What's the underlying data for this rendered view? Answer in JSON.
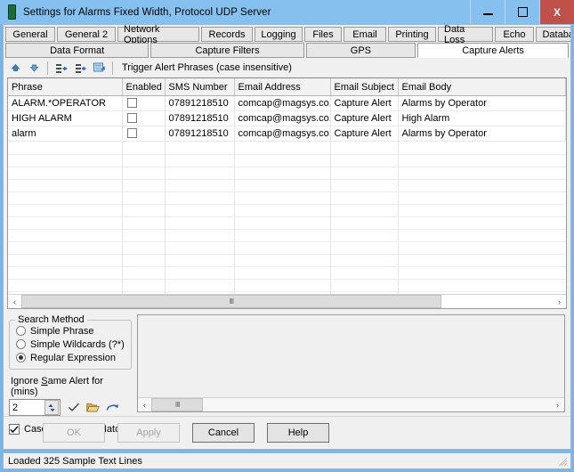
{
  "window": {
    "title": "Settings for Alarms Fixed Width, Protocol UDP Server",
    "icon": "document-icon",
    "minimize_label": "–",
    "maximize_label": "□",
    "close_label": "X"
  },
  "tabs": {
    "row1": [
      {
        "label": "General",
        "selected": false
      },
      {
        "label": "General 2",
        "selected": false
      },
      {
        "label": "Network Options",
        "selected": false
      },
      {
        "label": "Records",
        "selected": false
      },
      {
        "label": "Logging",
        "selected": false
      },
      {
        "label": "Files",
        "selected": false
      },
      {
        "label": "Email",
        "selected": false
      },
      {
        "label": "Printing",
        "selected": false
      },
      {
        "label": "Data Loss",
        "selected": false
      },
      {
        "label": "Echo",
        "selected": false
      },
      {
        "label": "Database",
        "selected": false
      }
    ],
    "row2": [
      {
        "label": "Data Format",
        "selected": false
      },
      {
        "label": "Capture Filters",
        "selected": false
      },
      {
        "label": "GPS",
        "selected": false
      },
      {
        "label": "Capture Alerts",
        "selected": true
      }
    ]
  },
  "toolbar": {
    "move_up": "move-up-icon",
    "move_down": "move-down-icon",
    "insert_row": "insert-row-icon",
    "delete_row": "delete-row-icon",
    "edit_row": "edit-row-icon",
    "caption": "Trigger Alert Phrases (case insensitive)"
  },
  "grid": {
    "columns": [
      "Phrase",
      "Enabled",
      "SMS Number",
      "Email Address",
      "Email Subject",
      "Email Body"
    ],
    "rows": [
      {
        "phrase": "ALARM.*OPERATOR",
        "enabled": false,
        "sms": "07891218510",
        "email": "comcap@magsys.co.uk",
        "subject": "Capture Alert",
        "body": "Alarms by Operator"
      },
      {
        "phrase": "HIGH ALARM",
        "enabled": false,
        "sms": "07891218510",
        "email": "comcap@magsys.co.uk",
        "subject": "Capture Alert",
        "body": "High Alarm"
      },
      {
        "phrase": "alarm",
        "enabled": false,
        "sms": "07891218510",
        "email": "comcap@magsys.co.uk",
        "subject": "Capture Alert",
        "body": "Alarms by Operator"
      }
    ],
    "scroll_left": "‹",
    "scroll_right": "›",
    "thumb_grip": "‖‖"
  },
  "search_method": {
    "title": "Search Method",
    "options": [
      {
        "label": "Simple Phrase",
        "selected": false
      },
      {
        "label": "Simple Wildcards (?*)",
        "selected": false
      },
      {
        "label": "Regular Expression",
        "selected": true
      }
    ]
  },
  "ignore_alert": {
    "label_pre": "Ignore ",
    "label_accel": "S",
    "label_post": "ame Alert for (mins)",
    "value": "2",
    "spinner_up": "▲",
    "spinner_down": "▼",
    "apply_icon": "check-icon",
    "open_icon": "folder-open-icon",
    "reset_icon": "redo-icon"
  },
  "case_insensitive": {
    "label": "Case Insensitive Match",
    "checked": true
  },
  "preview": {
    "content": "",
    "scroll_left": "‹",
    "scroll_right": "›",
    "thumb_grip": "‖‖"
  },
  "buttons": [
    {
      "label": "OK",
      "disabled": true
    },
    {
      "label": "Apply",
      "disabled": true
    },
    {
      "label": "Cancel",
      "disabled": false
    },
    {
      "label": "Help",
      "disabled": false
    }
  ],
  "statusbar": {
    "text": "Loaded 325 Sample Text Lines"
  },
  "colors": {
    "window_frame": "#7cb4e8",
    "titlebar": "#85c0ef",
    "close_button": "#c0504a",
    "accent_icon": "#2b63a8"
  }
}
